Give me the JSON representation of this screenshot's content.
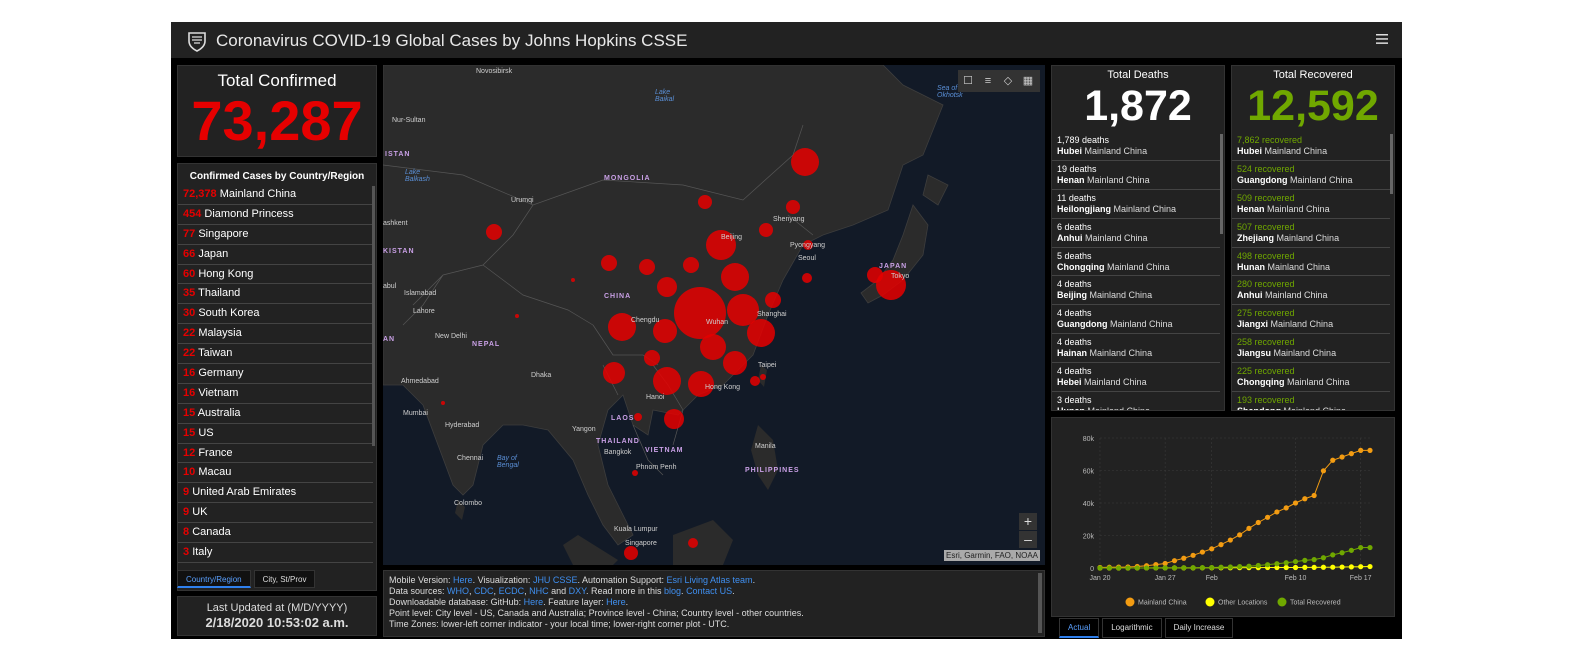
{
  "header": {
    "title": "Coronavirus COVID-19 Global Cases by Johns Hopkins CSSE"
  },
  "total_confirmed": {
    "label": "Total Confirmed",
    "value": "73,287"
  },
  "country_panel": {
    "title": "Confirmed Cases by Country/Region",
    "rows": [
      {
        "value": "72,378",
        "name": "Mainland China"
      },
      {
        "value": "454",
        "name": "Diamond Princess"
      },
      {
        "value": "77",
        "name": "Singapore"
      },
      {
        "value": "66",
        "name": "Japan"
      },
      {
        "value": "60",
        "name": "Hong Kong"
      },
      {
        "value": "35",
        "name": "Thailand"
      },
      {
        "value": "30",
        "name": "South Korea"
      },
      {
        "value": "22",
        "name": "Malaysia"
      },
      {
        "value": "22",
        "name": "Taiwan"
      },
      {
        "value": "16",
        "name": "Germany"
      },
      {
        "value": "16",
        "name": "Vietnam"
      },
      {
        "value": "15",
        "name": "Australia"
      },
      {
        "value": "15",
        "name": "US"
      },
      {
        "value": "12",
        "name": "France"
      },
      {
        "value": "10",
        "name": "Macau"
      },
      {
        "value": "9",
        "name": "United Arab Emirates"
      },
      {
        "value": "9",
        "name": "UK"
      },
      {
        "value": "8",
        "name": "Canada"
      },
      {
        "value": "3",
        "name": "Italy"
      }
    ],
    "tabs": [
      "Country/Region",
      "City, St/Prov"
    ]
  },
  "last_updated": {
    "label": "Last Updated at (M/D/YYYY)",
    "value": "2/18/2020 10:53:02 a.m."
  },
  "map": {
    "attribution": "Esri, Garmin, FAO, NOAA",
    "labels": {
      "novosibirsk": "Novosibirsk",
      "nur_sultan": "Nur-Sultan",
      "istan": "ISTAN",
      "lake_baikal": "Lake Baikal",
      "lake_balkash": "Lake Balkash",
      "sea_okhotsk": "Sea of Okhotsk",
      "mongolia": "MONGOLIA",
      "urumqi": "Urumqi",
      "shenyang": "Shenyang",
      "beijing": "Beijing",
      "pyongyang": "Pyongyang",
      "seoul": "Seoul",
      "japan": "JAPAN",
      "tokyo": "Tokyo",
      "tashkent": "ashkent",
      "kistan": "KISTAN",
      "kabul": "abul",
      "islamabad": "Islamabad",
      "china": "CHINA",
      "lahore": "Lahore",
      "chengdu": "Chengdu",
      "wuhan": "Wuhan",
      "shanghai": "Shanghai",
      "an": "AN",
      "new_delhi": "New Delhi",
      "nepal": "NEPAL",
      "taipei": "Taipei",
      "ahmedabad": "Ahmedabad",
      "dhaka": "Dhaka",
      "hong_kong": "Hong Kong",
      "hanoi": "Hanoi",
      "mumbai": "Mumbai",
      "laos": "LAOS",
      "hyderabad": "Hyderabad",
      "yangon": "Yangon",
      "thailand": "THAILAND",
      "vietnam": "VIETNAM",
      "manila": "Manila",
      "chennai": "Chennai",
      "bay_bengal": "Bay of Bengal",
      "bangkok": "Bangkok",
      "philippines": "PHILIPPINES",
      "phnom_penh": "Phnom Penh",
      "colombo": "Colombo",
      "kuala_lumpur": "Kuala Lumpur",
      "singapore": "Singapore"
    }
  },
  "info": {
    "line1": {
      "a": "Mobile Version: ",
      "b": "Here",
      "c": ". Visualization: ",
      "d": "JHU CSSE",
      "e": ". Automation Support: ",
      "f": "Esri Living Atlas team",
      "g": "."
    },
    "line2": {
      "a": "Data sources: ",
      "b": "WHO",
      "c": ", ",
      "d": "CDC",
      "e": ", ",
      "f": "ECDC",
      "g": ", ",
      "h": "NHC",
      "i": " and ",
      "j": "DXY",
      "k": ". Read more in this ",
      "l": "blog",
      "m": ". ",
      "n": "Contact US",
      "o": "."
    },
    "line3": {
      "a": "Downloadable database: GitHub: ",
      "b": "Here",
      "c": ". Feature layer: ",
      "d": "Here",
      "e": "."
    },
    "line4": "Point level: City level - US, Canada and Australia; Province level - China; Country level - other countries.",
    "line5": "Time Zones: lower-left corner indicator - your local time; lower-right corner plot - UTC."
  },
  "deaths": {
    "label": "Total Deaths",
    "value": "1,872",
    "rows": [
      {
        "count": "1,789 deaths",
        "region": "Hubei",
        "country": "Mainland China"
      },
      {
        "count": "19 deaths",
        "region": "Henan",
        "country": "Mainland China"
      },
      {
        "count": "11 deaths",
        "region": "Heilongjiang",
        "country": "Mainland China"
      },
      {
        "count": "6 deaths",
        "region": "Anhui",
        "country": "Mainland China"
      },
      {
        "count": "5 deaths",
        "region": "Chongqing",
        "country": "Mainland China"
      },
      {
        "count": "4 deaths",
        "region": "Beijing",
        "country": "Mainland China"
      },
      {
        "count": "4 deaths",
        "region": "Guangdong",
        "country": "Mainland China"
      },
      {
        "count": "4 deaths",
        "region": "Hainan",
        "country": "Mainland China"
      },
      {
        "count": "4 deaths",
        "region": "Hebei",
        "country": "Mainland China"
      },
      {
        "count": "3 deaths",
        "region": "Hunan",
        "country": "Mainland China"
      }
    ]
  },
  "recovered": {
    "label": "Total Recovered",
    "value": "12,592",
    "rows": [
      {
        "count": "7,862 recovered",
        "region": "Hubei",
        "country": "Mainland China"
      },
      {
        "count": "524 recovered",
        "region": "Guangdong",
        "country": "Mainland China"
      },
      {
        "count": "509 recovered",
        "region": "Henan",
        "country": "Mainland China"
      },
      {
        "count": "507 recovered",
        "region": "Zhejiang",
        "country": "Mainland China"
      },
      {
        "count": "498 recovered",
        "region": "Hunan",
        "country": "Mainland China"
      },
      {
        "count": "280 recovered",
        "region": "Anhui",
        "country": "Mainland China"
      },
      {
        "count": "275 recovered",
        "region": "Jiangxi",
        "country": "Mainland China"
      },
      {
        "count": "258 recovered",
        "region": "Jiangsu",
        "country": "Mainland China"
      },
      {
        "count": "225 recovered",
        "region": "Chongqing",
        "country": "Mainland China"
      },
      {
        "count": "193 recovered",
        "region": "Shandong",
        "country": "Mainland China"
      }
    ]
  },
  "chart_tabs": [
    "Actual",
    "Logarithmic",
    "Daily Increase"
  ],
  "colors": {
    "confirmed": "#e60000",
    "recovered": "#70a800",
    "mainland": "#f39c12",
    "other": "#ffff00"
  },
  "chart_data": {
    "type": "line",
    "x_ticks": [
      "Jan 20",
      "Jan 27",
      "Feb",
      "Feb 10",
      "Feb 17"
    ],
    "y_ticks": [
      "0",
      "20k",
      "40k",
      "60k",
      "80k"
    ],
    "ylim": [
      0,
      80000
    ],
    "x": [
      "2020-01-20",
      "2020-01-21",
      "2020-01-22",
      "2020-01-23",
      "2020-01-24",
      "2020-01-25",
      "2020-01-26",
      "2020-01-27",
      "2020-01-28",
      "2020-01-29",
      "2020-01-30",
      "2020-01-31",
      "2020-02-01",
      "2020-02-02",
      "2020-02-03",
      "2020-02-04",
      "2020-02-05",
      "2020-02-06",
      "2020-02-07",
      "2020-02-08",
      "2020-02-09",
      "2020-02-10",
      "2020-02-11",
      "2020-02-12",
      "2020-02-13",
      "2020-02-14",
      "2020-02-15",
      "2020-02-16",
      "2020-02-17",
      "2020-02-18"
    ],
    "series": [
      {
        "name": "Mainland China",
        "color": "#f39c12",
        "values": [
          300,
          440,
          550,
          640,
          920,
          1400,
          2100,
          2800,
          4500,
          6000,
          7800,
          9800,
          11800,
          14400,
          17200,
          20400,
          24400,
          28000,
          31200,
          34500,
          37000,
          40000,
          42600,
          44600,
          59800,
          66300,
          68300,
          70400,
          72400,
          72400
        ]
      },
      {
        "name": "Other Locations",
        "color": "#ffff00",
        "values": [
          5,
          8,
          10,
          15,
          20,
          30,
          40,
          50,
          60,
          70,
          90,
          120,
          140,
          150,
          160,
          180,
          200,
          240,
          270,
          290,
          310,
          320,
          370,
          400,
          450,
          500,
          580,
          670,
          800,
          900
        ]
      },
      {
        "name": "Total Recovered",
        "color": "#70a800",
        "values": [
          25,
          28,
          30,
          32,
          36,
          39,
          49,
          58,
          101,
          120,
          135,
          214,
          275,
          463,
          614,
          843,
          1112,
          1540,
          2050,
          2616,
          3244,
          3946,
          4683,
          5150,
          6295,
          8058,
          9395,
          10865,
          12561,
          12592
        ]
      }
    ],
    "legend_position": "bottom"
  }
}
